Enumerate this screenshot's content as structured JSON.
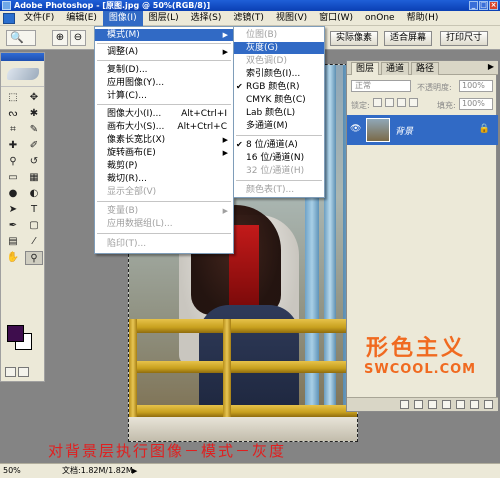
{
  "window": {
    "title": "Adobe Photoshop - [原图.jpg @ 50%(RGB/8)]",
    "controls": [
      "_",
      "□",
      "×"
    ]
  },
  "menubar": {
    "items": [
      {
        "label": "文件(F)"
      },
      {
        "label": "编辑(E)"
      },
      {
        "label": "图像(I)"
      },
      {
        "label": "图层(L)"
      },
      {
        "label": "选择(S)"
      },
      {
        "label": "滤镜(T)"
      },
      {
        "label": "视图(V)"
      },
      {
        "label": "窗口(W)"
      },
      {
        "label": "onOne"
      },
      {
        "label": "帮助(H)"
      }
    ],
    "active_index": 2
  },
  "options_bar": {
    "zoom_tool": "🔍",
    "zoom_in": "⊕",
    "zoom_out": "⊖",
    "actual_pixels": "实际像素",
    "fit_screen": "适合屏幕",
    "print_size": "打印尺寸"
  },
  "image_menu": {
    "items": [
      {
        "label": "模式(M)",
        "submenu": true,
        "highlight": true
      },
      {
        "separator": true
      },
      {
        "label": "调整(A)",
        "submenu": true
      },
      {
        "separator": true
      },
      {
        "label": "复制(D)..."
      },
      {
        "label": "应用图像(Y)..."
      },
      {
        "label": "计算(C)..."
      },
      {
        "separator": true
      },
      {
        "label": "图像大小(I)...",
        "shortcut": "Alt+Ctrl+I"
      },
      {
        "label": "画布大小(S)...",
        "shortcut": "Alt+Ctrl+C"
      },
      {
        "label": "像素长宽比(X)",
        "submenu": true
      },
      {
        "label": "旋转画布(E)",
        "submenu": true
      },
      {
        "label": "裁剪(P)"
      },
      {
        "label": "裁切(R)..."
      },
      {
        "label": "显示全部(V)",
        "disabled": true
      },
      {
        "separator": true
      },
      {
        "label": "变量(B)",
        "submenu": true,
        "disabled": true
      },
      {
        "label": "应用数据组(L)...",
        "disabled": true
      },
      {
        "separator": true
      },
      {
        "label": "陷印(T)...",
        "disabled": true
      }
    ]
  },
  "mode_submenu": {
    "items": [
      {
        "label": "位图(B)",
        "disabled": true
      },
      {
        "label": "灰度(G)",
        "highlight": true
      },
      {
        "label": "双色调(D)",
        "disabled": true
      },
      {
        "label": "索引颜色(I)..."
      },
      {
        "label": "RGB 颜色(R)",
        "checked": true
      },
      {
        "label": "CMYK 颜色(C)"
      },
      {
        "label": "Lab 颜色(L)"
      },
      {
        "label": "多通道(M)"
      },
      {
        "separator": true
      },
      {
        "label": "8 位/通道(A)",
        "checked": true
      },
      {
        "label": "16 位/通道(N)"
      },
      {
        "label": "32 位/通道(H)",
        "disabled": true
      },
      {
        "separator": true
      },
      {
        "label": "颜色表(T)...",
        "disabled": true
      }
    ]
  },
  "layers_panel": {
    "tabs": [
      "图层",
      "通道",
      "路径"
    ],
    "blend_mode": "正常",
    "opacity_label": "不透明度:",
    "opacity_value": "100%",
    "lock_label": "锁定:",
    "fill_label": "填充:",
    "fill_value": "100%",
    "layer_name": "背景"
  },
  "watermark": {
    "cn": "形色主义",
    "en": "SWCOOL.COM",
    "color": "#f06a20"
  },
  "caption": "对背景层执行图像－模式－灰度",
  "statusbar": {
    "zoom": "50%",
    "doc_info": "文档:1.82M/1.82M"
  },
  "colors": {
    "foreground": "#3e0d4d",
    "background": "#ffffff",
    "highlight": "#316ac5"
  }
}
